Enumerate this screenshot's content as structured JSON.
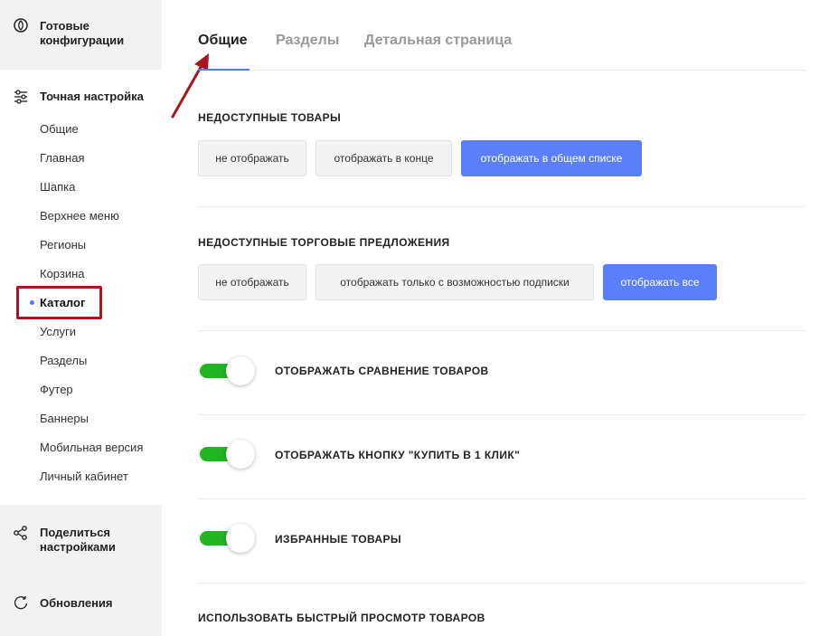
{
  "sidebar": {
    "ready_configs": "Готовые конфигурации",
    "fine_tuning": "Точная настройка",
    "items": [
      {
        "label": "Общие"
      },
      {
        "label": "Главная"
      },
      {
        "label": "Шапка"
      },
      {
        "label": "Верхнее меню"
      },
      {
        "label": "Регионы"
      },
      {
        "label": "Корзина"
      },
      {
        "label": "Каталог",
        "active": true
      },
      {
        "label": "Услуги"
      },
      {
        "label": "Разделы"
      },
      {
        "label": "Футер"
      },
      {
        "label": "Баннеры"
      },
      {
        "label": "Мобильная версия"
      },
      {
        "label": "Личный кабинет"
      }
    ],
    "share_settings": "Поделиться настройками",
    "updates": "Обновления"
  },
  "tabs": [
    {
      "label": "Общие",
      "active": true
    },
    {
      "label": "Разделы"
    },
    {
      "label": "Детальная страница"
    }
  ],
  "sections": {
    "unavailable_goods": {
      "title": "НЕДОСТУПНЫЕ ТОВАРЫ",
      "options": [
        "не отображать",
        "отображать в конце",
        "отображать в общем списке"
      ],
      "selected": "отображать в общем списке"
    },
    "unavailable_offers": {
      "title": "НЕДОСТУПНЫЕ ТОРГОВЫЕ ПРЕДЛОЖЕНИЯ",
      "options": [
        "не отображать",
        "отображать только с возможностью подписки",
        "отображать все"
      ],
      "selected": "отображать все"
    },
    "toggles": [
      {
        "label": "ОТОБРАЖАТЬ СРАВНЕНИЕ ТОВАРОВ",
        "on": true
      },
      {
        "label": "ОТОБРАЖАТЬ КНОПКУ \"КУПИТЬ В 1 КЛИК\"",
        "on": true
      },
      {
        "label": "ИЗБРАННЫЕ ТОВАРЫ",
        "on": true
      }
    ],
    "quick_view": {
      "title": "ИСПОЛЬЗОВАТЬ БЫСТРЫЙ ПРОСМОТР ТОВАРОВ"
    }
  },
  "colors": {
    "accent": "#5b7ff8",
    "toggle_on": "#21b521",
    "highlight": "#a11820"
  }
}
